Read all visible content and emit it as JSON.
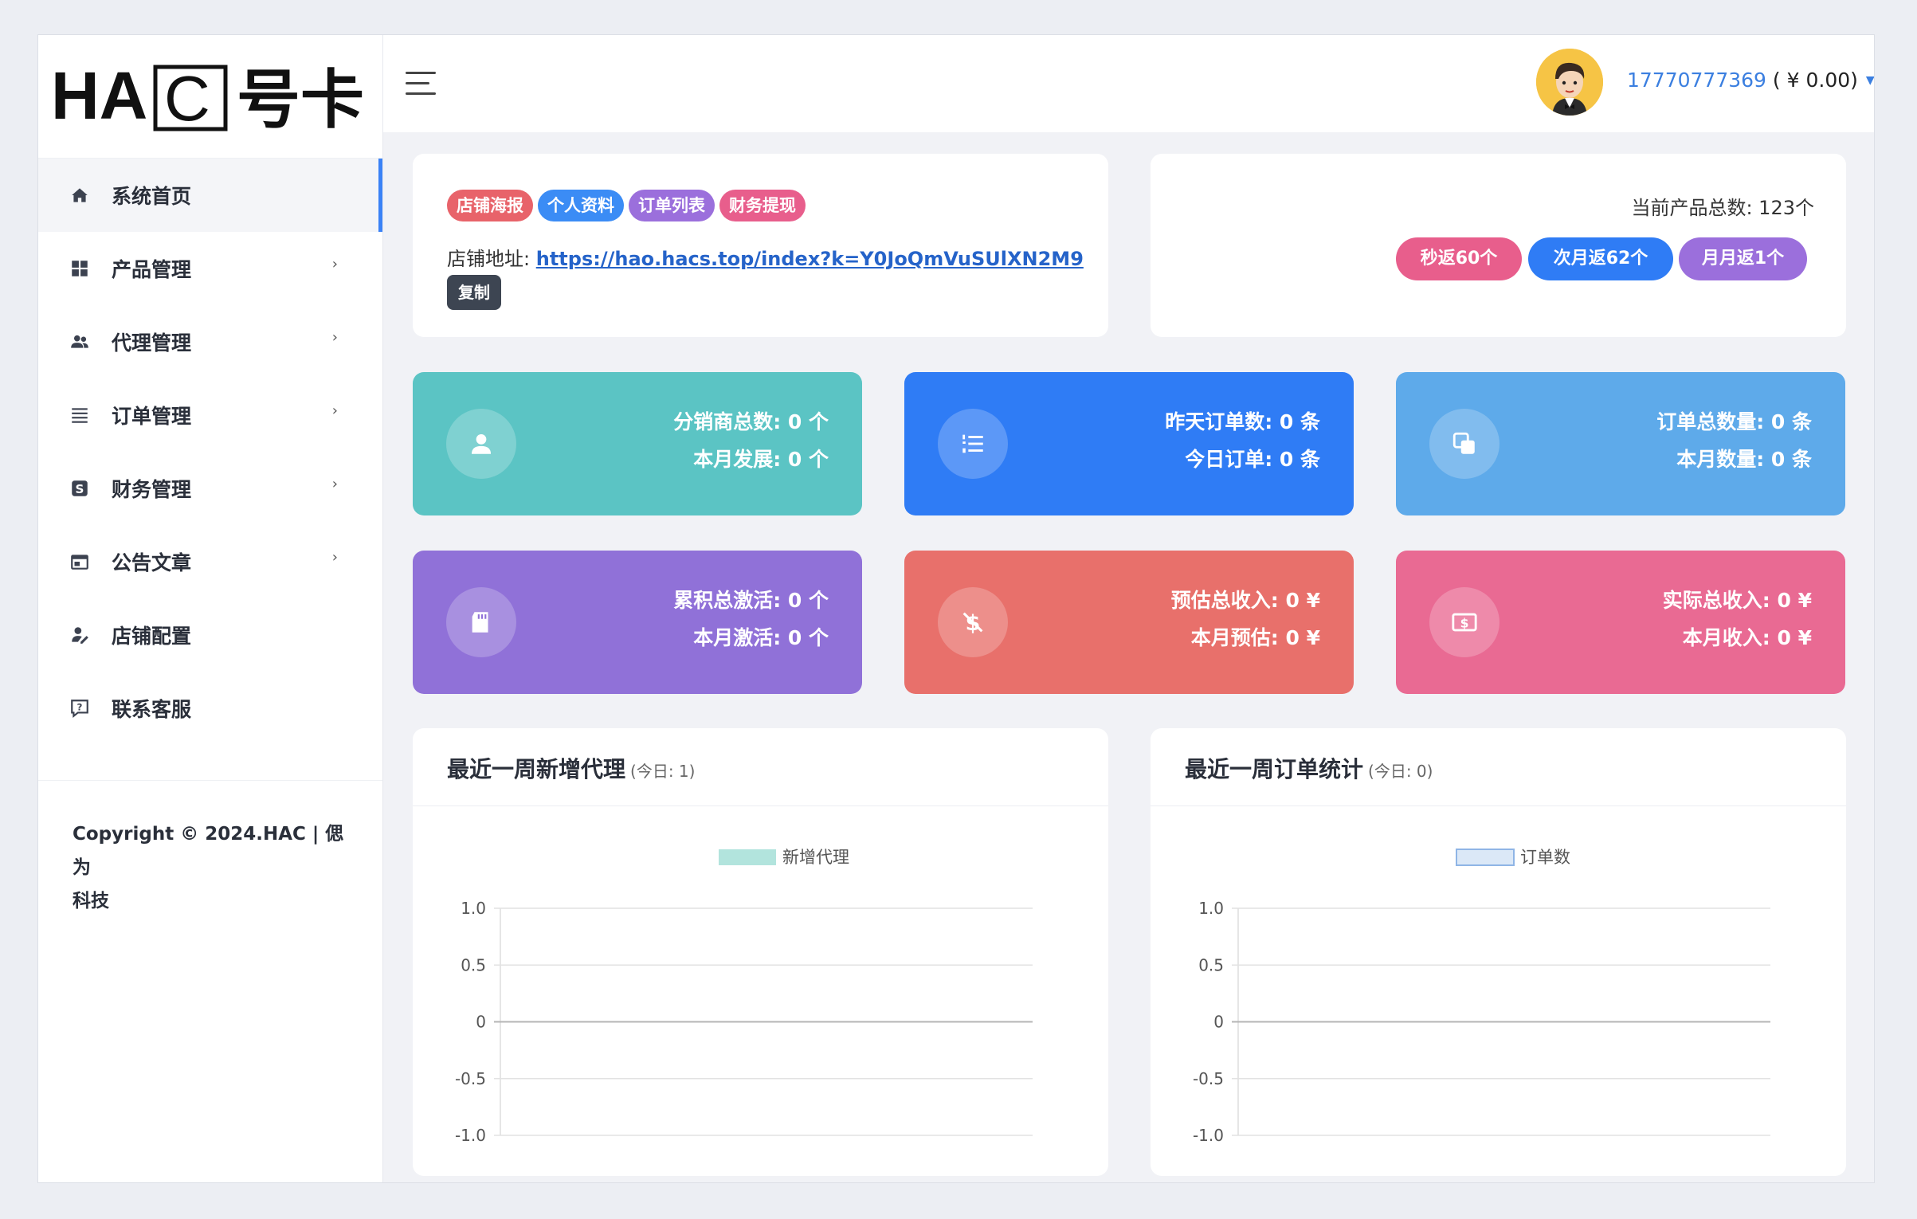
{
  "logo": {
    "text": "HAC号卡"
  },
  "sidebar": {
    "items": [
      {
        "label": "系统首页",
        "icon": "home-icon",
        "has_caret": false,
        "active": true
      },
      {
        "label": "产品管理",
        "icon": "grid-icon",
        "has_caret": true
      },
      {
        "label": "代理管理",
        "icon": "users-icon",
        "has_caret": true
      },
      {
        "label": "订单管理",
        "icon": "list-icon",
        "has_caret": true
      },
      {
        "label": "财务管理",
        "icon": "dollar-square-icon",
        "has_caret": true
      },
      {
        "label": "公告文章",
        "icon": "calendar-icon",
        "has_caret": true
      },
      {
        "label": "店铺配置",
        "icon": "user-edit-icon",
        "has_caret": false
      },
      {
        "label": "联系客服",
        "icon": "help-message-icon",
        "has_caret": false
      }
    ],
    "caret": "›",
    "footer": {
      "line1": "Copyright © 2024.HAC | 偲为",
      "line2": "科技"
    }
  },
  "header": {
    "user_phone": "17770777369",
    "user_balance": " ( ¥ 0.00)",
    "caret": "▼"
  },
  "shop": {
    "tags": [
      {
        "label": "店铺海报",
        "color": "#e8636a"
      },
      {
        "label": "个人资料",
        "color": "#3b8cf5"
      },
      {
        "label": "订单列表",
        "color": "#9b6fdc"
      },
      {
        "label": "财务提现",
        "color": "#e85e8c"
      }
    ],
    "address_label": "店铺地址:",
    "address_url": "https://hao.hacs.top/index?k=Y0JoQmVuSUlXN2M9",
    "copy_label": "复制"
  },
  "products": {
    "total": "当前产品总数: 123个",
    "pills": [
      {
        "label": "秒返60个",
        "color": "#e85e8c"
      },
      {
        "label": "次月返62个",
        "color": "#2f7cf5"
      },
      {
        "label": "月月返1个",
        "color": "#9b6fdc"
      }
    ]
  },
  "stats": [
    {
      "line1": "分销商总数: 0 个",
      "line2": "本月发展: 0 个",
      "color": "#5bc4c4",
      "icon": "user-icon"
    },
    {
      "line1": "昨天订单数: 0 条",
      "line2": "今日订单: 0 条",
      "color": "#2f7cf5",
      "icon": "list-icon"
    },
    {
      "line1": "订单总数量: 0 条",
      "line2": "本月数量: 0 条",
      "color": "#5eaaea",
      "icon": "copy-icon"
    },
    {
      "line1": "累积总激活: 0 个",
      "line2": "本月激活: 0 个",
      "color": "#9071d8",
      "icon": "sd-card-icon"
    },
    {
      "line1": "预估总收入: 0 ¥",
      "line2": "本月预估: 0 ¥",
      "color": "#e8706b",
      "icon": "dollar-off-icon"
    },
    {
      "line1": "实际总收入: 0 ¥",
      "line2": "本月收入: 0 ¥",
      "color": "#e96a93",
      "icon": "money-icon"
    }
  ],
  "charts": {
    "agents": {
      "title": "最近一周新增代理",
      "subtitle": "(今日: 1)"
    },
    "orders": {
      "title": "最近一周订单统计",
      "subtitle": "(今日: 0)"
    }
  },
  "chart_data": [
    {
      "type": "line",
      "series": [
        {
          "name": "新增代理",
          "values": [],
          "color": "#b2e4dd"
        }
      ],
      "ylim": [
        -1.0,
        1.0
      ],
      "y_ticks": [
        "1.0",
        "0.5",
        "0",
        "-0.5",
        "-1.0"
      ],
      "grid": true,
      "legend": "top-center"
    },
    {
      "type": "line",
      "series": [
        {
          "name": "订单数",
          "values": [],
          "color": "#dbe8f7"
        }
      ],
      "ylim": [
        -1.0,
        1.0
      ],
      "y_ticks": [
        "1.0",
        "0.5",
        "0",
        "-0.5",
        "-1.0"
      ],
      "grid": true,
      "legend": "top-center"
    }
  ]
}
